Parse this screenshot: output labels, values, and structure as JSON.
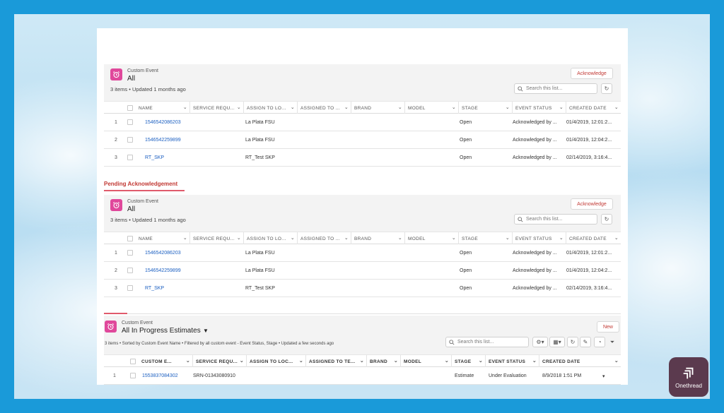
{
  "brand": {
    "logo_text": "Onethread"
  },
  "list1": {
    "object_type": "Custom Event",
    "title": "All",
    "meta": "3 items • Updated 1 months ago",
    "action_button": "Acknowledge",
    "search_placeholder": "Search this list...",
    "columns": [
      "NAME",
      "SERVICE REQU...",
      "ASSIGN TO LO...",
      "ASSIGNED TO ...",
      "BRAND",
      "MODEL",
      "STAGE",
      "EVENT STATUS",
      "CREATED DATE"
    ],
    "rows": [
      {
        "num": "1",
        "name": "1546542086203",
        "location": "La Plata FSU",
        "stage": "Open",
        "status": "Acknowledged by ...",
        "date": "01/4/2019, 12:01:2..."
      },
      {
        "num": "2",
        "name": "1546542259899",
        "location": "La Plata FSU",
        "stage": "Open",
        "status": "Acknowledged by ...",
        "date": "01/4/2019, 12:04:2..."
      },
      {
        "num": "3",
        "name": "RT_SKP",
        "location": "RT_Test SKP",
        "stage": "Open",
        "status": "Acknowledged by ...",
        "date": "02/14/2019, 3:16:4..."
      }
    ]
  },
  "tab": {
    "label": "Pending Acknowledgement"
  },
  "list2": {
    "object_type": "Custom Event",
    "title": "All",
    "meta": "3 items • Updated 1 months ago",
    "action_button": "Acknowledge",
    "search_placeholder": "Search this list...",
    "columns": [
      "NAME",
      "SERVICE REQU...",
      "ASSIGN TO LO...",
      "ASSIGNED TO ...",
      "BRAND",
      "MODEL",
      "STAGE",
      "EVENT STATUS",
      "CREATED DATE"
    ],
    "rows": [
      {
        "num": "1",
        "name": "1546542086203",
        "location": "La Plata FSU",
        "stage": "Open",
        "status": "Acknowledged by ...",
        "date": "01/4/2019, 12:01:2..."
      },
      {
        "num": "2",
        "name": "1546542259899",
        "location": "La Plata FSU",
        "stage": "Open",
        "status": "Acknowledged by ...",
        "date": "01/4/2019, 12:04:2..."
      },
      {
        "num": "3",
        "name": "RT_SKP",
        "location": "RT_Test SKP",
        "stage": "Open",
        "status": "Acknowledged by ...",
        "date": "02/14/2019, 3:16:4..."
      }
    ]
  },
  "list3": {
    "object_type": "Custom Event",
    "title": "All In Progress Estimates",
    "meta": "3 items • Sorted by Custom Event Name • Filtered by all custom event - Event Status, Stage • Updated a few seconds ago",
    "action_button": "New",
    "search_placeholder": "Search this list...",
    "columns": [
      "CUSTOM E...",
      "SERVICE REQU...",
      "ASSIGN TO LOC...",
      "ASSIGNED TO TE...",
      "BRAND",
      "MODEL",
      "STAGE",
      "EVENT STATUS",
      "CREATED DATE"
    ],
    "rows": [
      {
        "num": "1",
        "name": "1553837084302",
        "service": "SRN-01343080910",
        "stage": "Estimate",
        "status": "Under Evaluation",
        "date": "8/9/2018 1:51 PM"
      }
    ]
  },
  "colors": {
    "accent": "#e0489b",
    "link": "#1b5fc1",
    "tab": "#c23934"
  }
}
